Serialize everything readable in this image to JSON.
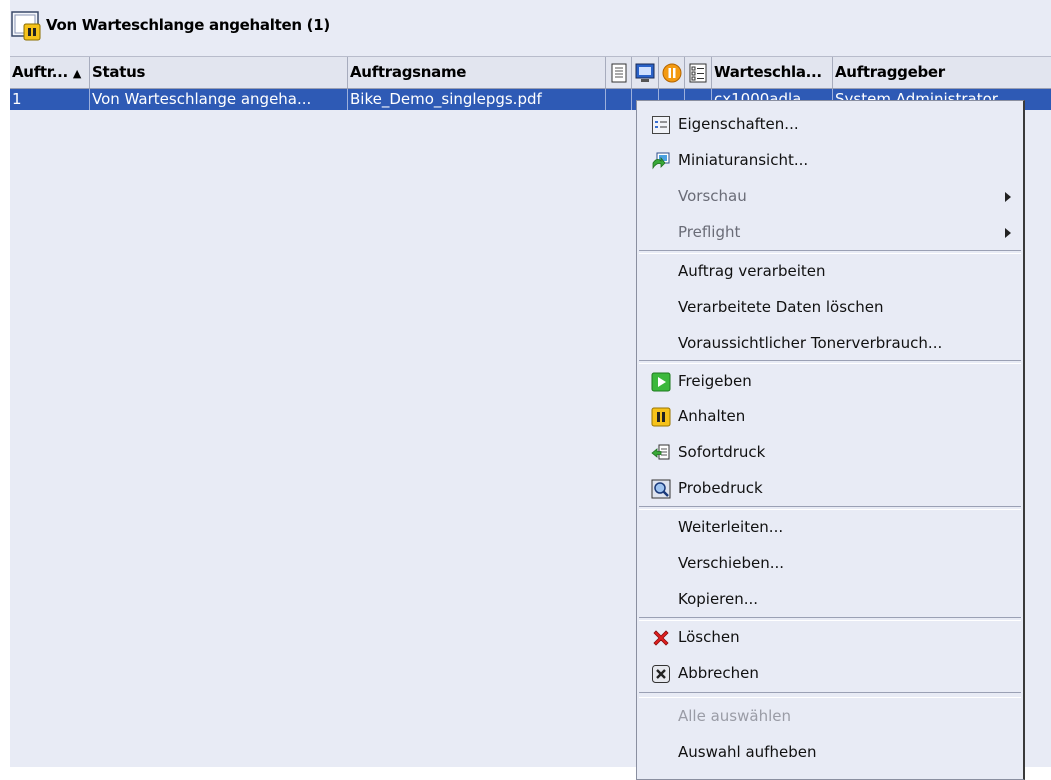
{
  "panel": {
    "title": "Von Warteschlange angehalten (1)",
    "icon": "queue-paused-icon"
  },
  "table": {
    "columns": [
      {
        "label": "Auftr...",
        "sort": "ascending"
      },
      {
        "label": "Status"
      },
      {
        "label": "Auftragsname"
      },
      {
        "icon": "document-icon"
      },
      {
        "icon": "monitor-icon"
      },
      {
        "icon": "pause-circle-icon"
      },
      {
        "icon": "checklist-icon"
      },
      {
        "label": "Warteschla..."
      },
      {
        "label": "Auftraggeber"
      }
    ],
    "rows": [
      {
        "id": "1",
        "status": "Von Warteschlange angeha...",
        "name": "Bike_Demo_singlepgs.pdf",
        "queue": "cx1000adla",
        "owner": "System Administrator"
      }
    ]
  },
  "context_menu": {
    "items": [
      {
        "label": "Eigenschaften...",
        "icon": "properties-icon"
      },
      {
        "label": "Miniaturansicht...",
        "icon": "thumbnail-icon"
      },
      {
        "label": "Vorschau",
        "submenu": true
      },
      {
        "label": "Preflight",
        "submenu": true
      },
      {
        "label": "Auftrag verarbeiten"
      },
      {
        "label": "Verarbeitete Daten löschen"
      },
      {
        "label": "Voraussichtlicher Tonerverbrauch..."
      },
      {
        "label": "Freigeben",
        "icon": "release-icon"
      },
      {
        "label": "Anhalten",
        "icon": "hold-icon"
      },
      {
        "label": "Sofortdruck",
        "icon": "instant-print-icon"
      },
      {
        "label": "Probedruck",
        "icon": "proof-print-icon"
      },
      {
        "label": "Weiterleiten..."
      },
      {
        "label": "Verschieben..."
      },
      {
        "label": "Kopieren..."
      },
      {
        "label": "Löschen",
        "icon": "delete-icon"
      },
      {
        "label": "Abbrechen",
        "icon": "cancel-icon"
      },
      {
        "label": "Alle auswählen",
        "disabled": true
      },
      {
        "label": "Auswahl aufheben"
      }
    ]
  },
  "colors": {
    "selection": "#2e5ab5",
    "panel_background": "#e8ebf5"
  }
}
